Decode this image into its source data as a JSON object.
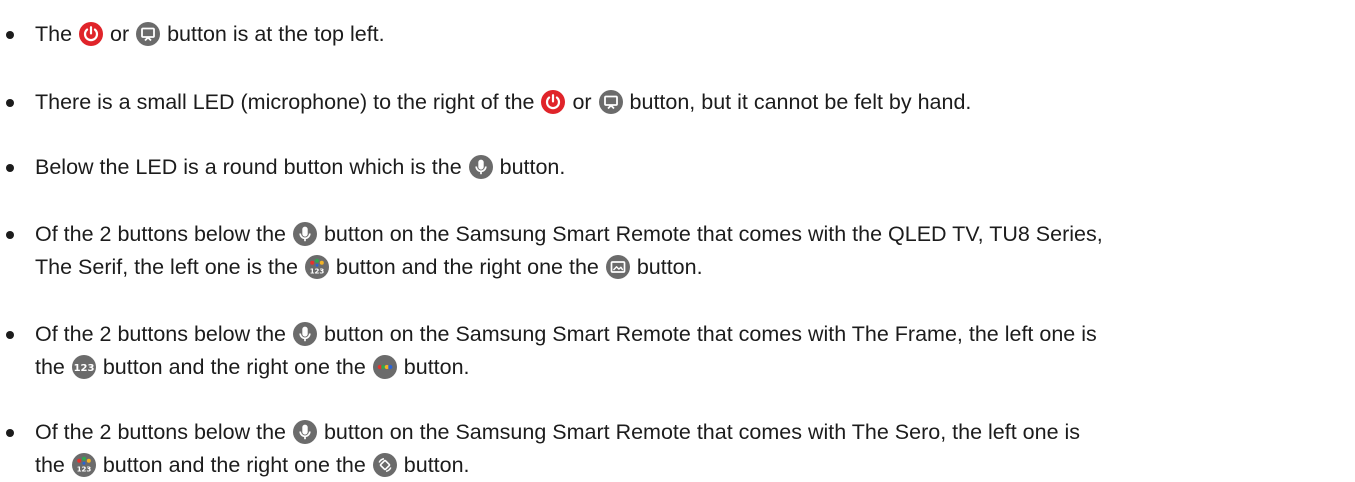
{
  "colors": {
    "text": "#1c1c1c",
    "power_red": "#e0242a",
    "icon_gray": "#6b6b6b",
    "color_red": "#e5322d",
    "color_green": "#2fa84f",
    "color_yellow": "#f3b325",
    "color_blue": "#2a62d6"
  },
  "items": [
    {
      "lines": [
        [
          {
            "t": "The "
          },
          {
            "icon": "power-icon"
          },
          {
            "t": " or "
          },
          {
            "icon": "ambient-icon"
          },
          {
            "t": " button is at the top left."
          }
        ]
      ]
    },
    {
      "lines": [
        [
          {
            "t": "There is a small LED (microphone) to the right of the "
          },
          {
            "icon": "power-icon"
          },
          {
            "t": " or "
          },
          {
            "icon": "ambient-icon"
          },
          {
            "t": " button, but it cannot be felt by hand."
          }
        ]
      ]
    },
    {
      "lines": [
        [
          {
            "t": "Below the LED is a round button which is the "
          },
          {
            "icon": "microphone-icon"
          },
          {
            "t": " button."
          }
        ]
      ]
    },
    {
      "lines": [
        [
          {
            "t": "Of the 2 buttons below the "
          },
          {
            "icon": "microphone-icon"
          },
          {
            "t": " button on the Samsung Smart Remote that comes with the QLED TV, TU8 Series,"
          }
        ],
        [
          {
            "t": "The Serif, the left one is the "
          },
          {
            "icon": "color-123-icon"
          },
          {
            "t": " button and the right one the "
          },
          {
            "icon": "ambient-mode-icon"
          },
          {
            "t": " button."
          }
        ]
      ]
    },
    {
      "lines": [
        [
          {
            "t": "Of the 2 buttons below the "
          },
          {
            "icon": "microphone-icon"
          },
          {
            "t": " button on the Samsung Smart Remote that comes with The Frame, the left one is"
          }
        ],
        [
          {
            "t": "the "
          },
          {
            "icon": "number-123-icon"
          },
          {
            "t": " button and the right one the "
          },
          {
            "icon": "color-dots-icon"
          },
          {
            "t": " button."
          }
        ]
      ]
    },
    {
      "lines": [
        [
          {
            "t": "Of the 2 buttons below the "
          },
          {
            "icon": "microphone-icon"
          },
          {
            "t": " button on the Samsung Smart Remote that comes with The Sero, the left one is"
          }
        ],
        [
          {
            "t": "the "
          },
          {
            "icon": "color-123-icon"
          },
          {
            "t": " button and the right one the "
          },
          {
            "icon": "rotate-icon"
          },
          {
            "t": " button."
          }
        ]
      ]
    }
  ]
}
